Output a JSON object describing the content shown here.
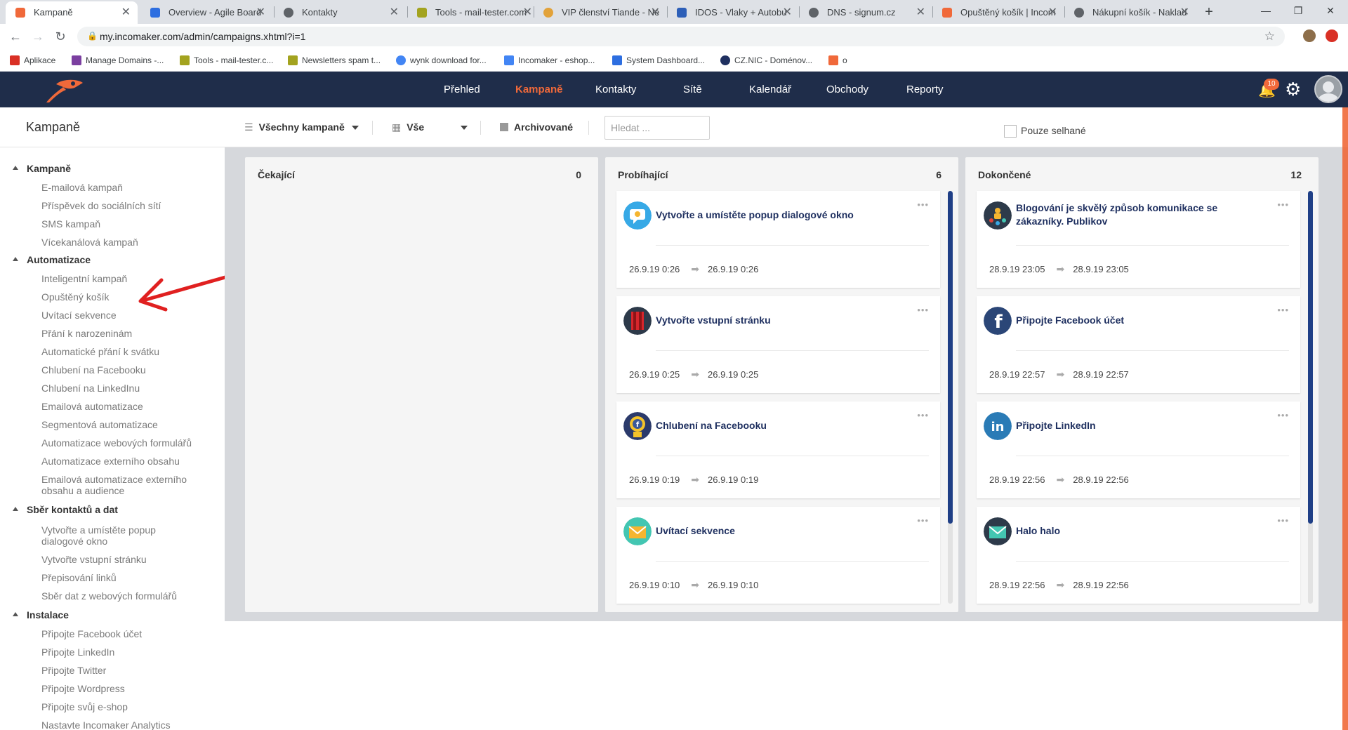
{
  "browser": {
    "tabs": [
      {
        "label": "Kampaně",
        "color": "#f0693a"
      },
      {
        "label": "Overview - Agile Board",
        "color": "#2d6ee0"
      },
      {
        "label": "Kontakty",
        "color": "#5f6368"
      },
      {
        "label": "Tools - mail-tester.com",
        "color": "#a3a31f"
      },
      {
        "label": "VIP členství Tiande - Ne",
        "color": "#e2a23a"
      },
      {
        "label": "IDOS - Vlaky + Autobu",
        "color": "#2d5fb8"
      },
      {
        "label": "DNS - signum.cz",
        "color": "#5f6368"
      },
      {
        "label": "Opuštěný košík | Incom",
        "color": "#f0693a"
      },
      {
        "label": "Nákupní košík - Naklad",
        "color": "#5f6368"
      }
    ],
    "url": "my.incomaker.com/admin/campaigns.xhtml?i=1",
    "bookmarks": [
      {
        "label": "Aplikace",
        "color": "#d93025"
      },
      {
        "label": "Manage Domains -...",
        "color": "#7b3fa0"
      },
      {
        "label": "Tools - mail-tester.c...",
        "color": "#a3a31f"
      },
      {
        "label": "Newsletters spam t...",
        "color": "#a3a31f"
      },
      {
        "label": "wynk download for...",
        "color": "#4285f4"
      },
      {
        "label": "Incomaker - eshop...",
        "color": "#4285f4"
      },
      {
        "label": "System Dashboard...",
        "color": "#2d6ee0"
      },
      {
        "label": "CZ.NIC - Doménov...",
        "color": "#1f3060"
      },
      {
        "label": "o",
        "color": "#f0693a"
      }
    ]
  },
  "app": {
    "nav": [
      "Přehled",
      "Kampaně",
      "Kontakty",
      "Sítě",
      "Kalendář",
      "Obchody",
      "Reporty"
    ],
    "active_nav": "Kampaně",
    "notifications": "10",
    "accent": "#f0693a",
    "header_bg": "#1f2d4a"
  },
  "toolbar": {
    "title": "Kampaně",
    "filter_all": "Všechny kampaně",
    "filter_time": "Vše",
    "archived": "Archivované",
    "search_placeholder": "Hledat ...",
    "only_failed": "Pouze selhané"
  },
  "sidebar": {
    "sections": [
      {
        "title": "Kampaně",
        "items": [
          "E-mailová kampaň",
          "Příspěvek do sociálních sítí",
          "SMS kampaň",
          "Vícekanálová kampaň"
        ]
      },
      {
        "title": "Automatizace",
        "items": [
          "Inteligentní kampaň",
          "Opuštěný košík",
          "Uvítací sekvence",
          "Přání k narozeninám",
          "Automatické přání k svátku",
          "Chlubení na Facebooku",
          "Chlubení na LinkedInu",
          "Emailová automatizace",
          "Segmentová automatizace",
          "Automatizace webových formulářů",
          "Automatizace externího obsahu",
          "Emailová automatizace externího obsahu a audience"
        ]
      },
      {
        "title": "Sběr kontaktů a dat",
        "items": [
          "Vytvořte a umístěte popup dialogové okno",
          "Vytvořte vstupní stránku",
          "Přepisování linků",
          "Sběr dat z webových formulářů"
        ]
      },
      {
        "title": "Instalace",
        "items": [
          "Připojte Facebook účet",
          "Připojte LinkedIn",
          "Připojte Twitter",
          "Připojte Wordpress",
          "Připojte svůj e-shop",
          "Nastavte Incomaker Analytics"
        ]
      }
    ]
  },
  "board": {
    "columns": [
      {
        "name": "Čekající",
        "count": "0",
        "cards": []
      },
      {
        "name": "Probíhající",
        "count": "6",
        "cards": [
          {
            "title": "Vytvořte a umístěte popup dialogové okno",
            "start": "26.9.19 0:26",
            "end": "26.9.19 0:26",
            "icon": "popup-icon"
          },
          {
            "title": "Vytvořte vstupní stránku",
            "start": "26.9.19 0:25",
            "end": "26.9.19 0:25",
            "icon": "landing-page-icon"
          },
          {
            "title": "Chlubení na Facebooku",
            "start": "26.9.19 0:19",
            "end": "26.9.19 0:19",
            "icon": "facebook-brag-icon"
          },
          {
            "title": "Uvítací sekvence",
            "start": "26.9.19 0:10",
            "end": "26.9.19 0:10",
            "icon": "welcome-envelope-icon"
          }
        ]
      },
      {
        "name": "Dokončené",
        "count": "12",
        "cards": [
          {
            "title": "Blogování je skvělý způsob komunikace se zákazníky. Publikov",
            "start": "28.9.19 23:05",
            "end": "28.9.19 23:05",
            "icon": "blog-icon"
          },
          {
            "title": "Připojte Facebook účet",
            "start": "28.9.19 22:57",
            "end": "28.9.19 22:57",
            "icon": "facebook-icon"
          },
          {
            "title": "Připojte LinkedIn",
            "start": "28.9.19 22:56",
            "end": "28.9.19 22:56",
            "icon": "linkedin-icon"
          },
          {
            "title": "Halo halo",
            "start": "28.9.19 22:56",
            "end": "28.9.19 22:56",
            "icon": "envelope-icon"
          }
        ]
      }
    ]
  }
}
